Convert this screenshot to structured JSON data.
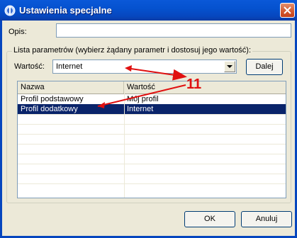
{
  "window": {
    "title": "Ustawienia specjalne"
  },
  "description": {
    "label": "Opis:",
    "value": ""
  },
  "params_group": {
    "title": "Lista parametrów (wybierz żądany parametr i dostosuj jego wartość):",
    "value_label": "Wartość:",
    "value_combo": "Internet",
    "next_button": "Dalej"
  },
  "list": {
    "columns": [
      "Nazwa",
      "Wartość"
    ],
    "rows": [
      {
        "name": "Profil podstawowy",
        "value": "Mój profil"
      },
      {
        "name": "Profil dodatkowy",
        "value": "Internet"
      }
    ],
    "selected_row": 1
  },
  "buttons": {
    "ok": "OK",
    "cancel": "Anuluj"
  },
  "annotation": {
    "number": "11",
    "color": "#e01010"
  },
  "colors": {
    "titlebar": "#0552cf",
    "selection": "#0a246a",
    "dialog_bg": "#ece9d8"
  }
}
